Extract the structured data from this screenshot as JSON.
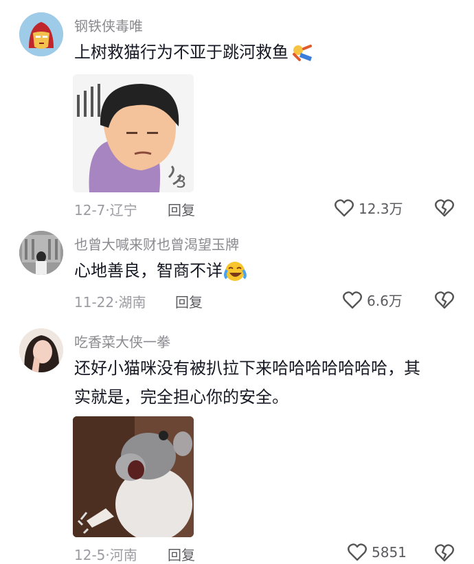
{
  "comments": [
    {
      "username": "钢铁侠毒唯",
      "text": "上树救猫行为不亚于跳河救鱼",
      "emoji": "falling-man-emoji",
      "date": "12-7",
      "location": "辽宁",
      "reply": "回复",
      "likes": "12.3万",
      "avatar": "iron-man-avatar"
    },
    {
      "username": "也曾大喊来财也曾渴望玉牌",
      "text": "心地善良，智商不详",
      "emoji": "laughing-crying-emoji",
      "date": "11-22",
      "location": "湖南",
      "reply": "回复",
      "likes": "6.6万",
      "avatar": "girl-building-avatar"
    },
    {
      "username": "吃香菜大侠一拳",
      "text_line1": "还好小猫咪没有被扒拉下来哈哈哈哈哈哈哈，其",
      "text_line2": "实就是，完全担心你的安全。",
      "date": "12-5",
      "location": "河南",
      "reply": "回复",
      "likes": "5851",
      "avatar": "girl-selfie-avatar"
    }
  ],
  "colors": {
    "username": "#8a8a8f",
    "meta": "#9b9ba1",
    "text": "#161823"
  }
}
